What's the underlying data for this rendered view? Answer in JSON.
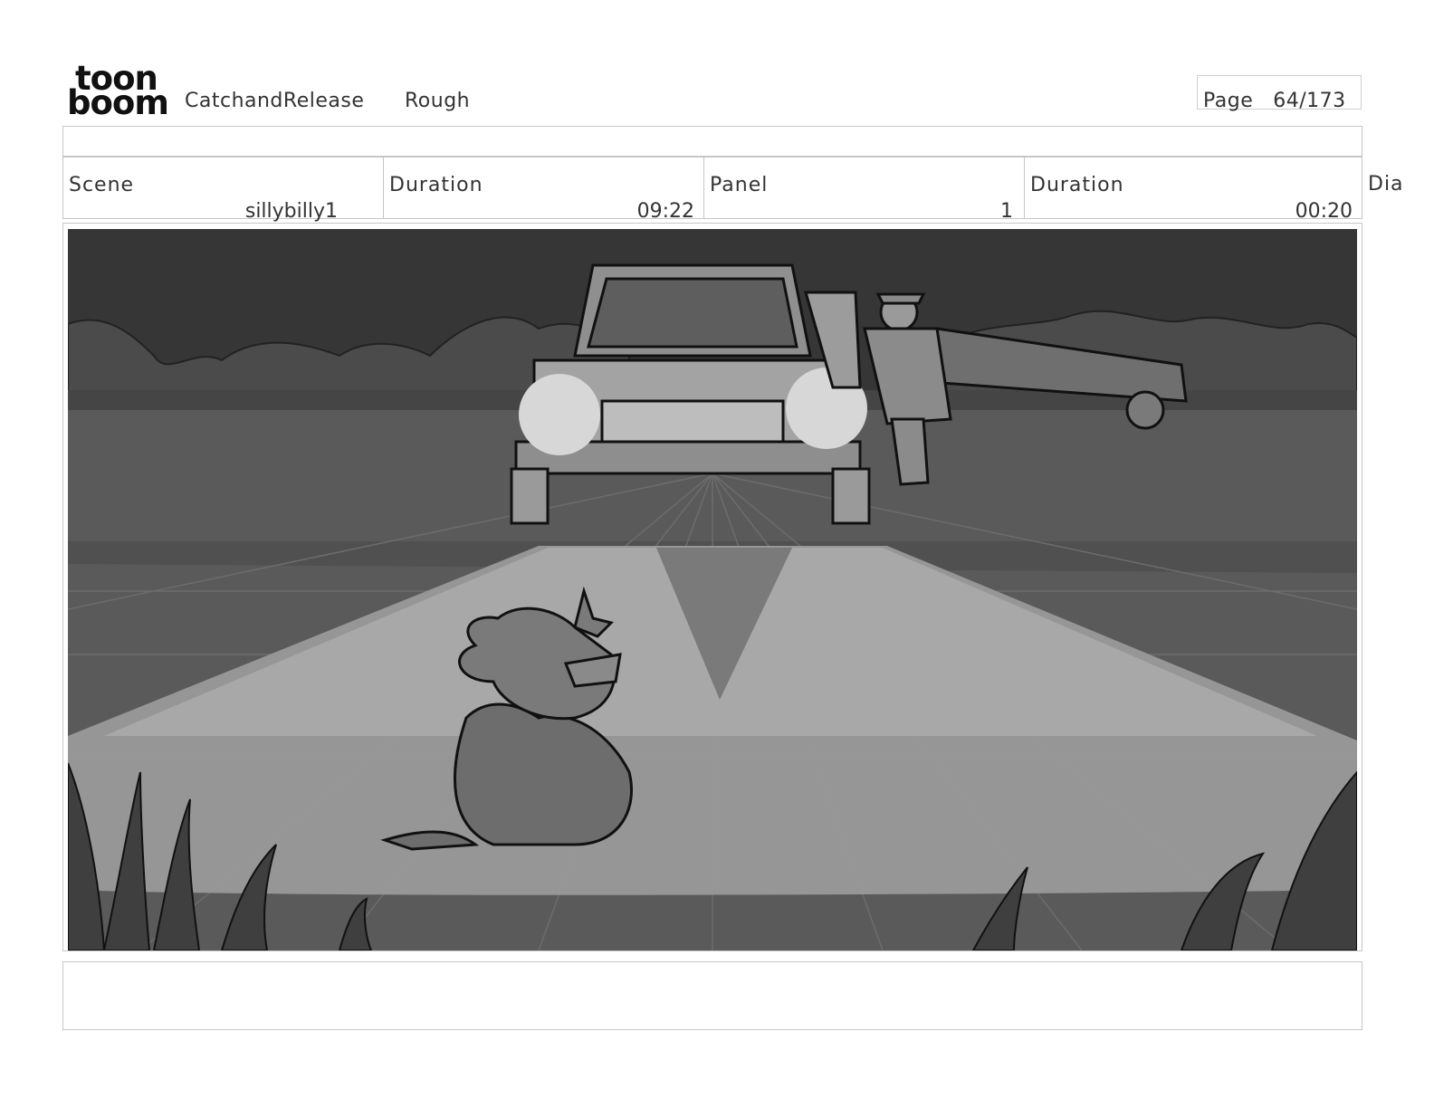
{
  "header": {
    "logo_top": "toon",
    "logo_bottom": "boom",
    "project": "CatchandRelease",
    "status": "Rough",
    "page_label": "Page",
    "page_value": "64/173"
  },
  "info": {
    "scene_label": "Scene",
    "scene_value": "sillybilly1",
    "scene_duration_label": "Duration",
    "scene_duration_value": "09:22",
    "panel_label": "Panel",
    "panel_value": "1",
    "panel_duration_label": "Duration",
    "panel_duration_value": "00:20",
    "dialogue_label": "Dia"
  },
  "panel_image": {
    "content": "storyboard sketch: pickup truck with headlights on a field at night, farmer standing by the door, small cartoon creature sitting in the headlight beam",
    "palette": "grayscale"
  }
}
